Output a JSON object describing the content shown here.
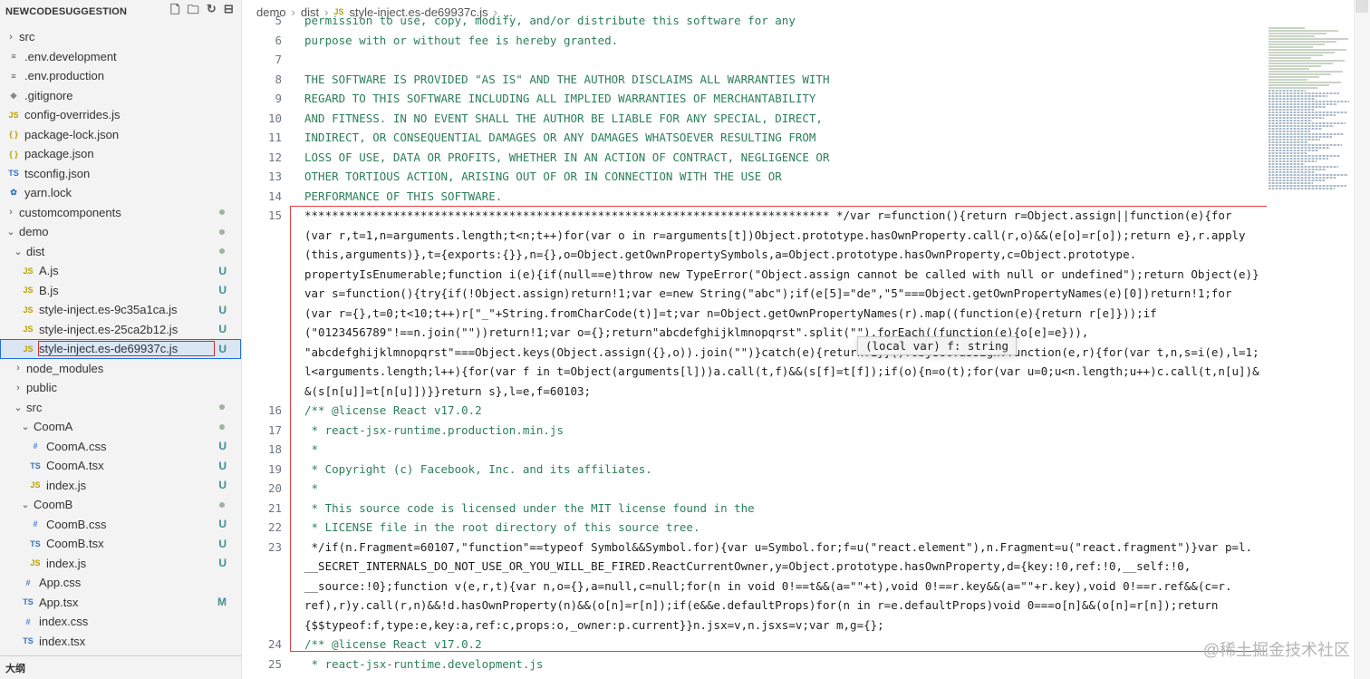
{
  "sidebar": {
    "title": "NEWCODESUGGESTION",
    "items": [
      {
        "label": "src",
        "type": "folder",
        "indent": 0,
        "expanded": false
      },
      {
        "label": ".env.development",
        "type": "env",
        "indent": 0
      },
      {
        "label": ".env.production",
        "type": "env",
        "indent": 0
      },
      {
        "label": ".gitignore",
        "type": "git",
        "indent": 0
      },
      {
        "label": "config-overrides.js",
        "type": "js",
        "indent": 0
      },
      {
        "label": "package-lock.json",
        "type": "json",
        "indent": 0
      },
      {
        "label": "package.json",
        "type": "json",
        "indent": 0
      },
      {
        "label": "tsconfig.json",
        "type": "tsjson",
        "indent": 0
      },
      {
        "label": "yarn.lock",
        "type": "yarn",
        "indent": 0
      },
      {
        "label": "customcomponents",
        "type": "folder",
        "indent": 0,
        "expanded": false,
        "dot": true
      },
      {
        "label": "demo",
        "type": "folder",
        "indent": 0,
        "expanded": true,
        "dot": true
      },
      {
        "label": "dist",
        "type": "folder",
        "indent": 1,
        "expanded": true,
        "dot": true
      },
      {
        "label": "A.js",
        "type": "js",
        "indent": 2,
        "badge": "U"
      },
      {
        "label": "B.js",
        "type": "js",
        "indent": 2,
        "badge": "U"
      },
      {
        "label": "style-inject.es-9c35a1ca.js",
        "type": "js",
        "indent": 2,
        "badge": "U"
      },
      {
        "label": "style-inject.es-25ca2b12.js",
        "type": "js",
        "indent": 2,
        "badge": "U"
      },
      {
        "label": "style-inject.es-de69937c.js",
        "type": "js",
        "indent": 2,
        "badge": "U",
        "selected": true
      },
      {
        "label": "node_modules",
        "type": "folder",
        "indent": 1,
        "expanded": false
      },
      {
        "label": "public",
        "type": "folder",
        "indent": 1,
        "expanded": false
      },
      {
        "label": "src",
        "type": "folder",
        "indent": 1,
        "expanded": true,
        "dot": true
      },
      {
        "label": "CoomA",
        "type": "folder",
        "indent": 2,
        "expanded": true,
        "dot": true
      },
      {
        "label": "CoomA.css",
        "type": "css",
        "indent": 3,
        "badge": "U"
      },
      {
        "label": "CoomA.tsx",
        "type": "ts",
        "indent": 3,
        "badge": "U"
      },
      {
        "label": "index.js",
        "type": "js",
        "indent": 3,
        "badge": "U"
      },
      {
        "label": "CoomB",
        "type": "folder",
        "indent": 2,
        "expanded": true,
        "dot": true
      },
      {
        "label": "CoomB.css",
        "type": "css",
        "indent": 3,
        "badge": "U"
      },
      {
        "label": "CoomB.tsx",
        "type": "ts",
        "indent": 3,
        "badge": "U"
      },
      {
        "label": "index.js",
        "type": "js",
        "indent": 3,
        "badge": "U"
      },
      {
        "label": "App.css",
        "type": "css",
        "indent": 2
      },
      {
        "label": "App.tsx",
        "type": "ts",
        "indent": 2,
        "badge": "M"
      },
      {
        "label": "index.css",
        "type": "css",
        "indent": 2
      },
      {
        "label": "index.tsx",
        "type": "ts",
        "indent": 2
      }
    ],
    "outline_label": "大纲"
  },
  "breadcrumb": {
    "parts": [
      "demo",
      "dist",
      "style-inject.es-de69937c.js",
      "..."
    ]
  },
  "editor": {
    "lines": [
      {
        "n": "5",
        "t": "permission to use, copy, modify, and/or distribute this software for any",
        "k": "cmt"
      },
      {
        "n": "6",
        "t": "purpose with or without fee is hereby granted.",
        "k": "cmt"
      },
      {
        "n": "7",
        "t": "",
        "k": "cmt"
      },
      {
        "n": "8",
        "t": "THE SOFTWARE IS PROVIDED \"AS IS\" AND THE AUTHOR DISCLAIMS ALL WARRANTIES WITH",
        "k": "cmt"
      },
      {
        "n": "9",
        "t": "REGARD TO THIS SOFTWARE INCLUDING ALL IMPLIED WARRANTIES OF MERCHANTABILITY",
        "k": "cmt"
      },
      {
        "n": "10",
        "t": "AND FITNESS. IN NO EVENT SHALL THE AUTHOR BE LIABLE FOR ANY SPECIAL, DIRECT,",
        "k": "cmt"
      },
      {
        "n": "11",
        "t": "INDIRECT, OR CONSEQUENTIAL DAMAGES OR ANY DAMAGES WHATSOEVER RESULTING FROM",
        "k": "cmt"
      },
      {
        "n": "12",
        "t": "LOSS OF USE, DATA OR PROFITS, WHETHER IN AN ACTION OF CONTRACT, NEGLIGENCE OR",
        "k": "cmt"
      },
      {
        "n": "13",
        "t": "OTHER TORTIOUS ACTION, ARISING OUT OF OR IN CONNECTION WITH THE USE OR",
        "k": "cmt"
      },
      {
        "n": "14",
        "t": "PERFORMANCE OF THIS SOFTWARE.",
        "k": "cmt"
      },
      {
        "n": "15",
        "t": "***************************************************************************** */var r=function(){return r=Object.assign||function(e){for",
        "k": "code"
      },
      {
        "n": "",
        "t": "(var r,t=1,n=arguments.length;t<n;t++)for(var o in r=arguments[t])Object.prototype.hasOwnProperty.call(r,o)&&(e[o]=r[o]);return e},r.apply",
        "k": "code"
      },
      {
        "n": "",
        "t": "(this,arguments)},t={exports:{}},n={},o=Object.getOwnPropertySymbols,a=Object.prototype.hasOwnProperty,c=Object.prototype.",
        "k": "code"
      },
      {
        "n": "",
        "t": "propertyIsEnumerable;function i(e){if(null==e)throw new TypeError(\"Object.assign cannot be called with null or undefined\");return Object(e)}",
        "k": "code"
      },
      {
        "n": "",
        "t": "var s=function(){try{if(!Object.assign)return!1;var e=new String(\"abc\");if(e[5]=\"de\",\"5\"===Object.getOwnPropertyNames(e)[0])return!1;for",
        "k": "code"
      },
      {
        "n": "",
        "t": "(var r={},t=0;t<10;t++)r[\"_\"+String.fromCharCode(t)]=t;var n=Object.getOwnPropertyNames(r).map((function(e){return r[e]}));if",
        "k": "code"
      },
      {
        "n": "",
        "t": "(\"0123456789\"!==n.join(\"\"))return!1;var o={};return\"abcdefghijklmnopqrst\".split(\"\").forEach((function(e){o[e]=e})),",
        "k": "code"
      },
      {
        "n": "",
        "t": "\"abcdefghijklmnopqrst\"===Object.keys(Object.assign({},o)).join(\"\")}catch(e){return!1}}()?Object.assign:function(e,r){for(var t,n,s=i(e),l=1;",
        "k": "code"
      },
      {
        "n": "",
        "t": "l<arguments.length;l++){for(var f in t=Object(arguments[l]))a.call(t,f)&&(s[f]=t[f]);if(o){n=o(t);for(var u=0;u<n.length;u++)c.call(t,n[u])&",
        "k": "code"
      },
      {
        "n": "",
        "t": "&(s[n[u]]=t[n[u]])}}return s},l=e,f=60103;",
        "k": "code"
      },
      {
        "n": "16",
        "t": "/** @license React v17.0.2",
        "k": "cmt"
      },
      {
        "n": "17",
        "t": " * react-jsx-runtime.production.min.js",
        "k": "cmt"
      },
      {
        "n": "18",
        "t": " *",
        "k": "cmt"
      },
      {
        "n": "19",
        "t": " * Copyright (c) Facebook, Inc. and its affiliates.",
        "k": "cmt"
      },
      {
        "n": "20",
        "t": " *",
        "k": "cmt"
      },
      {
        "n": "21",
        "t": " * This source code is licensed under the MIT license found in the",
        "k": "cmt"
      },
      {
        "n": "22",
        "t": " * LICENSE file in the root directory of this source tree.",
        "k": "cmt"
      },
      {
        "n": "23",
        "t": " */if(n.Fragment=60107,\"function\"==typeof Symbol&&Symbol.for){var u=Symbol.for;f=u(\"react.element\"),n.Fragment=u(\"react.fragment\")}var p=l.",
        "k": "code"
      },
      {
        "n": "",
        "t": "__SECRET_INTERNALS_DO_NOT_USE_OR_YOU_WILL_BE_FIRED.ReactCurrentOwner,y=Object.prototype.hasOwnProperty,d={key:!0,ref:!0,__self:!0,",
        "k": "code"
      },
      {
        "n": "",
        "t": "__source:!0};function v(e,r,t){var n,o={},a=null,c=null;for(n in void 0!==t&&(a=\"\"+t),void 0!==r.key&&(a=\"\"+r.key),void 0!==r.ref&&(c=r.",
        "k": "code"
      },
      {
        "n": "",
        "t": "ref),r)y.call(r,n)&&!d.hasOwnProperty(n)&&(o[n]=r[n]);if(e&&e.defaultProps)for(n in r=e.defaultProps)void 0===o[n]&&(o[n]=r[n]);return",
        "k": "code"
      },
      {
        "n": "",
        "t": "{$$typeof:f,type:e,key:a,ref:c,props:o,_owner:p.current}}n.jsx=v,n.jsxs=v;var m,g={};",
        "k": "code"
      },
      {
        "n": "24",
        "t": "/** @license React v17.0.2",
        "k": "cmt"
      },
      {
        "n": "25",
        "t": " * react-jsx-runtime.development.js",
        "k": "cmt"
      }
    ],
    "tooltip": "(local var) f: string"
  },
  "watermark": "@稀土掘金技术社区",
  "colors": {
    "selection_outline": "#d0302a",
    "highlight_box": "#e04040",
    "comment": "#2b7f5a",
    "badge": "#3f8f8f"
  }
}
